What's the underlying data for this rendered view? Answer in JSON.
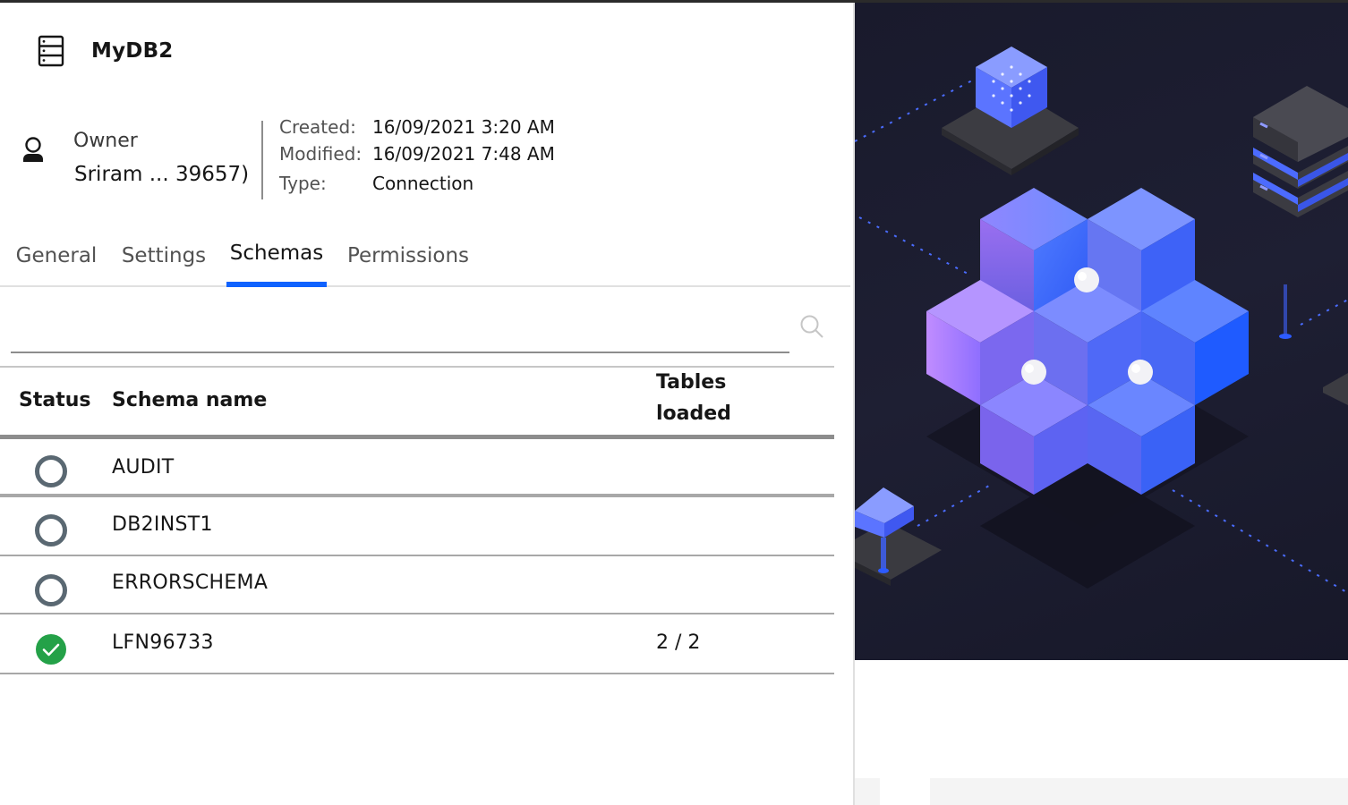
{
  "connection": {
    "title": "MyDB2",
    "owner_label": "Owner",
    "owner_name": "Sriram ... 39657)"
  },
  "metadata": {
    "created_label": "Created:",
    "created_value": "16/09/2021 3:20 AM",
    "modified_label": "Modified:",
    "modified_value": "16/09/2021 7:48 AM",
    "type_label": "Type:",
    "type_value": "Connection"
  },
  "tabs": [
    {
      "label": "General",
      "active": false
    },
    {
      "label": "Settings",
      "active": false
    },
    {
      "label": "Schemas",
      "active": true
    },
    {
      "label": "Permissions",
      "active": false
    }
  ],
  "search": {
    "placeholder": "",
    "value": ""
  },
  "table": {
    "headers": {
      "status": "Status",
      "schema_name": "Schema name",
      "tables_loaded_line1": "Tables",
      "tables_loaded_line2": "loaded"
    },
    "rows": [
      {
        "status": "not-loaded",
        "name": "AUDIT",
        "tables_loaded": ""
      },
      {
        "status": "not-loaded",
        "name": "DB2INST1",
        "tables_loaded": ""
      },
      {
        "status": "not-loaded",
        "name": "ERRORSCHEMA",
        "tables_loaded": ""
      },
      {
        "status": "loaded",
        "name": "LFN96733",
        "tables_loaded": "2 / 2"
      }
    ]
  },
  "colors": {
    "accent": "#0f62fe",
    "status_empty_ring": "#5a6872",
    "status_success": "#24a148",
    "illustration_bg": "#1c1d30"
  },
  "icons": {
    "header": "database-icon",
    "owner": "user-icon",
    "search": "search-icon",
    "status_not_loaded": "circle-outline-icon",
    "status_loaded": "checkmark-filled-icon"
  }
}
